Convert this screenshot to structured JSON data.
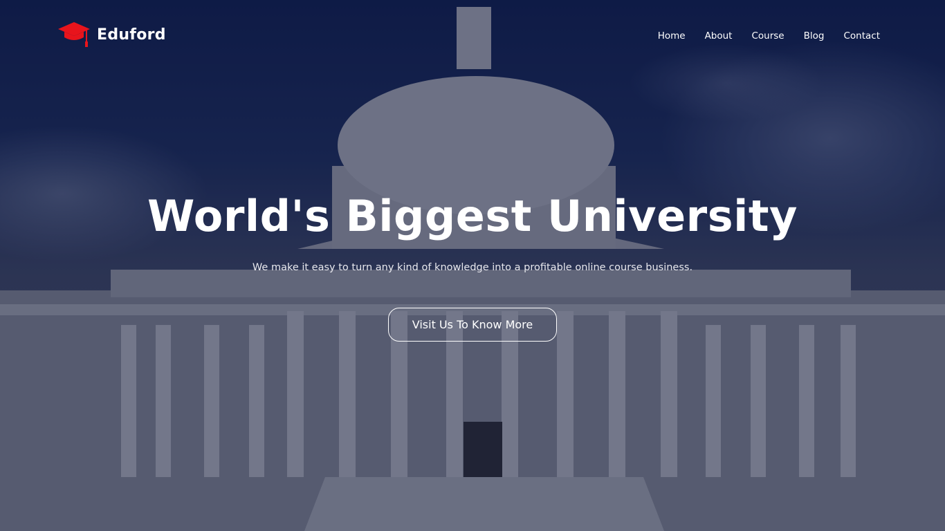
{
  "brand": {
    "name": "Eduford",
    "icon": "graduation-cap-icon",
    "accent": "#e8141c"
  },
  "nav": {
    "items": [
      {
        "label": "Home"
      },
      {
        "label": "About"
      },
      {
        "label": "Course"
      },
      {
        "label": "Blog"
      },
      {
        "label": "Contact"
      }
    ]
  },
  "hero": {
    "title": "World's Biggest University",
    "subtitle": "We make it easy to turn any kind of knowledge into a profitable online course business.",
    "cta_label": "Visit Us To Know More"
  }
}
